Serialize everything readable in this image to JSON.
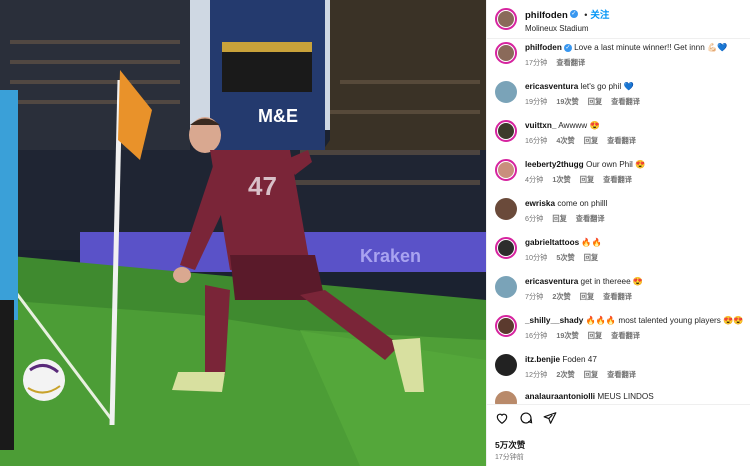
{
  "header": {
    "username": "philfoden",
    "follow_label": "关注",
    "location": "Molineux Stadium"
  },
  "photo": {
    "billboard_text": "M&E",
    "board_text": "Kraken",
    "shirt_number": "47"
  },
  "caption": {
    "username": "philfoden",
    "text": "Love a last minute winner!! Get innn",
    "emojis": "💪🏻💙",
    "time": "17分钟",
    "translate": "查看翻译"
  },
  "comments": [
    {
      "user": "ericasventura",
      "text": "let's go phil",
      "emoji": "💙",
      "time": "19分钟",
      "likes": "19次赞",
      "reply": "回复",
      "translate": "查看翻译",
      "avatar_color": "#7aa3b8"
    },
    {
      "user": "vuittxn_",
      "text": "Awwww",
      "emoji": "😍",
      "time": "16分钟",
      "likes": "4次赞",
      "reply": "回复",
      "translate": "查看翻译",
      "avatar_color": "#3b3b2a"
    },
    {
      "user": "leeberty2thugg",
      "text": "Our own Phil",
      "emoji": "😍",
      "time": "4分钟",
      "likes": "1次赞",
      "reply": "回复",
      "translate": "查看翻译",
      "avatar_color": "#c98f7d"
    },
    {
      "user": "ewriska",
      "text": "come on philll",
      "emoji": "",
      "time": "6分钟",
      "likes": "",
      "reply": "回复",
      "translate": "查看翻译",
      "avatar_color": "#6a4a3a"
    },
    {
      "user": "gabrieltattoos",
      "text": "",
      "emoji": "🔥🔥",
      "time": "10分钟",
      "likes": "5次赞",
      "reply": "回复",
      "translate": "",
      "avatar_color": "#2d2d2d"
    },
    {
      "user": "ericasventura",
      "text": "get in thereee",
      "emoji": "😍",
      "time": "7分钟",
      "likes": "2次赞",
      "reply": "回复",
      "translate": "查看翻译",
      "avatar_color": "#7aa3b8"
    },
    {
      "user": "_shilly__shady",
      "text": "most talented young players",
      "emoji": "🔥🔥🔥",
      "emoji2": "😍😍",
      "time": "16分钟",
      "likes": "19次赞",
      "reply": "回复",
      "translate": "查看翻译",
      "avatar_color": "#5b3a2e"
    },
    {
      "user": "itz.benjie",
      "text": "Foden 47",
      "emoji": "",
      "time": "12分钟",
      "likes": "2次赞",
      "reply": "回复",
      "translate": "查看翻译",
      "avatar_color": "#222222"
    },
    {
      "user": "analauraantoniolli",
      "text": "MEUS LINDOS",
      "emoji": "",
      "time": "",
      "likes": "",
      "reply": "",
      "translate": "",
      "avatar_color": "#b98a6a"
    }
  ],
  "footer": {
    "likes": "5万次赞",
    "time": "17分钟前"
  }
}
